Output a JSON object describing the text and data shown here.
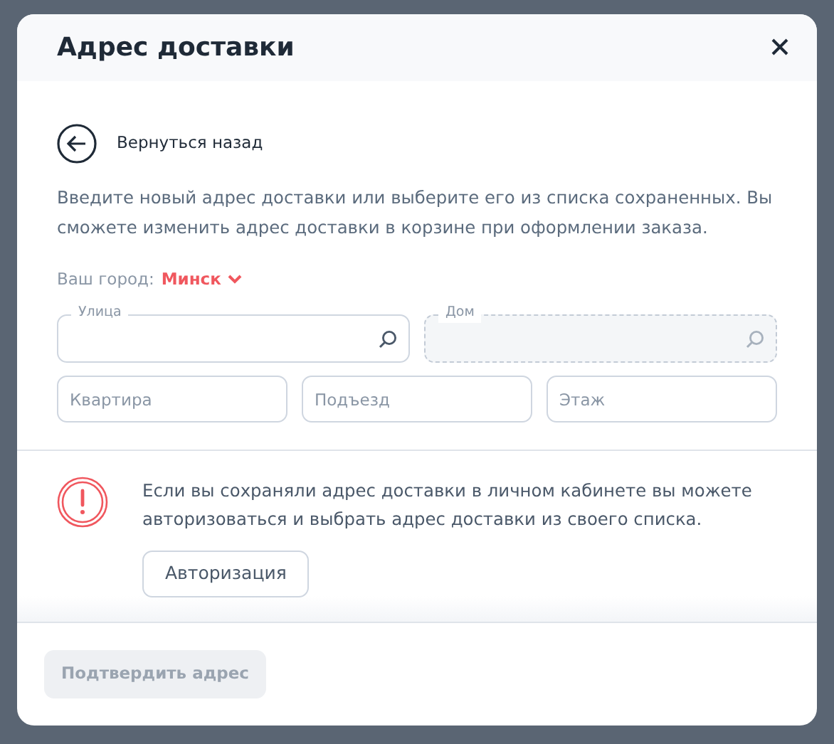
{
  "modal": {
    "title": "Адрес доставки"
  },
  "back_link": "Вернуться назад",
  "intro": "Введите новый адрес доставки или выберите его из списка сохраненных. Вы сможете изменить адрес доставки в корзине при оформлении заказа.",
  "city": {
    "label": "Ваш город:",
    "value": "Минск"
  },
  "search_fields": [
    {
      "label": "Улица",
      "disabled": false
    },
    {
      "label": "Дом",
      "disabled": true
    }
  ],
  "fields": [
    {
      "placeholder": "Квартира"
    },
    {
      "placeholder": "Подъезд"
    },
    {
      "placeholder": "Этаж"
    }
  ],
  "notice": {
    "text": "Если вы сохраняли адрес доставки в личном кабинете вы можете авторизоваться и выбрать адрес доставки из своего списка.",
    "button": "Авторизация"
  },
  "confirm": {
    "label": "Подтвердить адрес",
    "disabled": true
  }
}
